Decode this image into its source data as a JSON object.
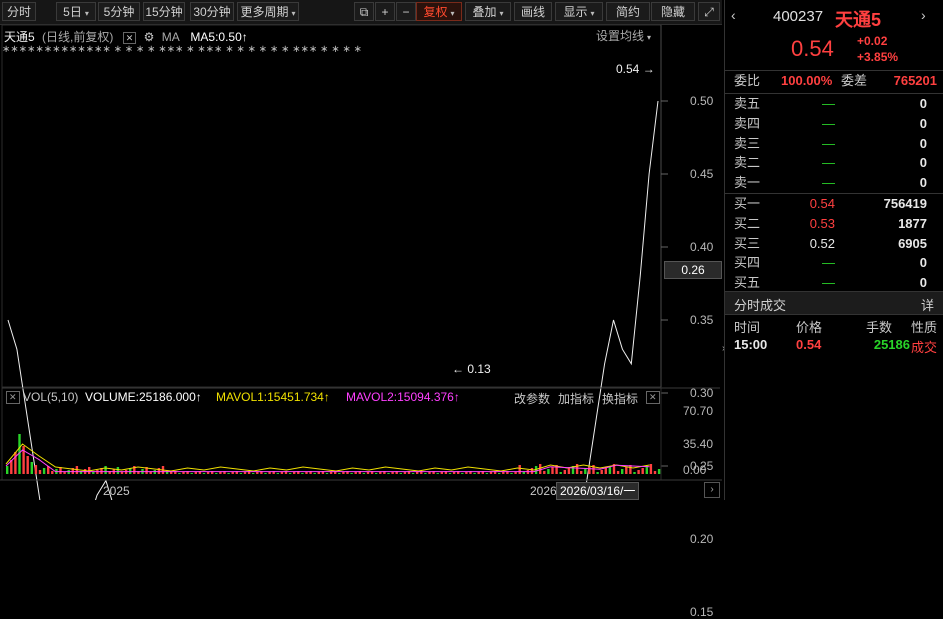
{
  "toolbar": {
    "tabs": [
      {
        "label": "分时",
        "caret": false
      },
      {
        "label": "5日",
        "caret": true
      },
      {
        "label": "5分钟",
        "caret": false
      },
      {
        "label": "15分钟",
        "caret": false
      },
      {
        "label": "30分钟",
        "caret": false
      },
      {
        "label": "更多周期",
        "caret": true
      },
      {
        "label": "复权",
        "caret": true,
        "active": true
      },
      {
        "label": "叠加",
        "caret": true
      },
      {
        "label": "画线",
        "caret": false
      },
      {
        "label": "显示",
        "caret": true
      },
      {
        "label": "简约",
        "caret": false
      },
      {
        "label": "隐藏",
        "caret": false
      }
    ]
  },
  "legend": {
    "name": "天通5",
    "info": "(日线,前复权)",
    "ma_label": "MA",
    "ma5": "MA5:0.50",
    "settings": "设置均线",
    "vol_label": "VOL(5,10)",
    "volume": "VOLUME:25186.000",
    "mavol1": "MAVOL1:15451.734",
    "mavol2": "MAVOL2:15094.376",
    "params": "改参数",
    "add_indicator": "加指标",
    "switch_indicator": "换指标"
  },
  "price_axis": {
    "ticks": [
      "0.50",
      "0.45",
      "0.40",
      "0.35",
      "0.30",
      "0.25",
      "0.20",
      "0.15"
    ],
    "current": "0.26"
  },
  "vol_axis": {
    "ticks": [
      "70.70",
      "35.40",
      "0.00"
    ]
  },
  "annotations": {
    "high": "0.54",
    "low": "0.13"
  },
  "x_axis": {
    "start_year": "2025",
    "end_year": "2026",
    "cursor_date": "2026/03/16/一"
  },
  "colors": {
    "up": "#ff4040",
    "down": "#29d429",
    "ma5": "#ffffff",
    "vol": "#ffffff",
    "mavol1": "#f0e000",
    "mavol2": "#ff40ff",
    "accent": "#ff4a2e"
  },
  "quote": {
    "code": "400237",
    "name": "天通5",
    "price": "0.54",
    "change": "+0.02",
    "change_pct": "+3.85%",
    "weibi_label": "委比",
    "weibi": "100.00%",
    "weicha_label": "委差",
    "weicha": "765201",
    "sell": [
      {
        "label": "卖五",
        "price": "—",
        "vol": "0"
      },
      {
        "label": "卖四",
        "price": "—",
        "vol": "0"
      },
      {
        "label": "卖三",
        "price": "—",
        "vol": "0"
      },
      {
        "label": "卖二",
        "price": "—",
        "vol": "0"
      },
      {
        "label": "卖一",
        "price": "—",
        "vol": "0"
      }
    ],
    "buy": [
      {
        "label": "买一",
        "price": "0.54",
        "vol": "756419",
        "color": "red"
      },
      {
        "label": "买二",
        "price": "0.53",
        "vol": "1877",
        "color": "red"
      },
      {
        "label": "买三",
        "price": "0.52",
        "vol": "6905",
        "color": "white"
      },
      {
        "label": "买四",
        "price": "—",
        "vol": "0",
        "color": "green"
      },
      {
        "label": "买五",
        "price": "—",
        "vol": "0",
        "color": "green"
      }
    ],
    "trades_title": "分时成交",
    "trades_detail": "详",
    "trades_headers": [
      "时间",
      "价格",
      "手数",
      "性质"
    ],
    "trades": [
      {
        "time": "15:00",
        "price": "0.54",
        "vol": "25186",
        "type": "成交"
      }
    ]
  },
  "chart_data": {
    "type": "line",
    "title": "天通5",
    "ylim": [
      0.11,
      0.55
    ],
    "series": [
      {
        "name": "MA5",
        "values": [
          0.35,
          0.33,
          0.29,
          0.25,
          0.21,
          0.19,
          0.18,
          0.18,
          0.19,
          0.21,
          0.23,
          0.24,
          0.22,
          0.21,
          0.2,
          0.2,
          0.195,
          0.195,
          0.195,
          0.19,
          0.19,
          0.19,
          0.19,
          0.2,
          0.2,
          0.21,
          0.2,
          0.195,
          0.195,
          0.19,
          0.19,
          0.185,
          0.18,
          0.175,
          0.175,
          0.175,
          0.175,
          0.175,
          0.172,
          0.172,
          0.17,
          0.17,
          0.17,
          0.168,
          0.168,
          0.165,
          0.165,
          0.16,
          0.155,
          0.15,
          0.145,
          0.145,
          0.15,
          0.155,
          0.155,
          0.16,
          0.165,
          0.175,
          0.19,
          0.17,
          0.16,
          0.16,
          0.17,
          0.19,
          0.21,
          0.24,
          0.28,
          0.32,
          0.35,
          0.33,
          0.32,
          0.38,
          0.45,
          0.5
        ]
      }
    ]
  }
}
